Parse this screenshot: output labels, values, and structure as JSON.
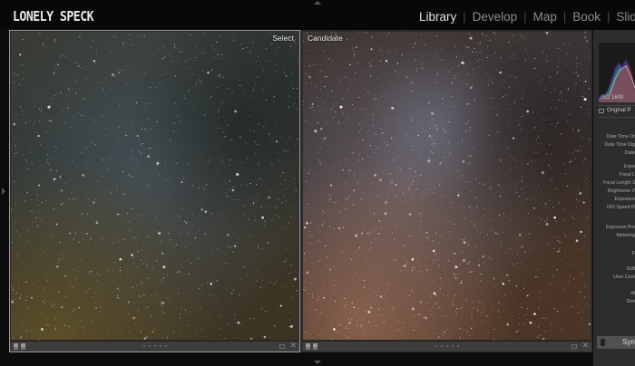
{
  "brand": "LONELY SPECK",
  "modules": [
    "Library",
    "Develop",
    "Map",
    "Book",
    "Slidesh"
  ],
  "active_module": "Library",
  "compare": {
    "left_label": "Select",
    "right_label": "Candidate"
  },
  "right_panel": {
    "histogram_iso": "ISO 1600",
    "original_label": "Original P",
    "metadata_labels": [
      "Date Time Or",
      "Date Time Dig",
      "Date",
      "Expo",
      "Focal L",
      "Focal Length 3",
      "Brightness V",
      "Exposure",
      "ISO Speed R",
      "Exposure Pro",
      "Metering",
      "F",
      "Soft",
      "User Com",
      "Al",
      "Dim"
    ],
    "sync_label": "Syn"
  },
  "colors": {
    "accent_text": "#e2e2e2",
    "panel_bg": "#2d2d2d",
    "select_border": "#9a9a9a"
  }
}
